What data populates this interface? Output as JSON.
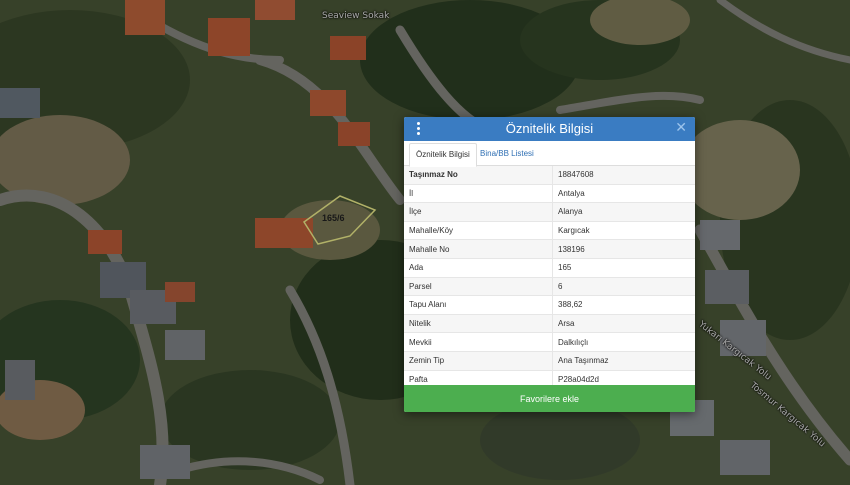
{
  "map": {
    "road_labels": [
      "Seaview Sokak",
      "Yukarı Kargıcak Yolu",
      "Tosmur Kargıcak Yolu"
    ],
    "parcel_label": "165/6"
  },
  "dialog": {
    "title": "Öznitelik Bilgisi",
    "menu_icon": "vertical-dots-icon",
    "close_icon": "close-icon",
    "tabs": [
      {
        "label": "Öznitelik Bilgisi",
        "active": true
      },
      {
        "label": "Bina/BB Listesi",
        "active": false
      }
    ],
    "rows": [
      {
        "key": "Taşınmaz No",
        "value": "18847608"
      },
      {
        "key": "İl",
        "value": "Antalya"
      },
      {
        "key": "İlçe",
        "value": "Alanya"
      },
      {
        "key": "Mahalle/Köy",
        "value": "Kargıcak"
      },
      {
        "key": "Mahalle No",
        "value": "138196"
      },
      {
        "key": "Ada",
        "value": "165"
      },
      {
        "key": "Parsel",
        "value": "6"
      },
      {
        "key": "Tapu Alanı",
        "value": "388,62"
      },
      {
        "key": "Nitelik",
        "value": "Arsa"
      },
      {
        "key": "Mevkii",
        "value": "Dalkılıçlı"
      },
      {
        "key": "Zemin Tip",
        "value": "Ana Taşınmaz"
      },
      {
        "key": "Pafta",
        "value": "P28a04d2d"
      }
    ],
    "favorite_button": "Favorilere ekle"
  }
}
